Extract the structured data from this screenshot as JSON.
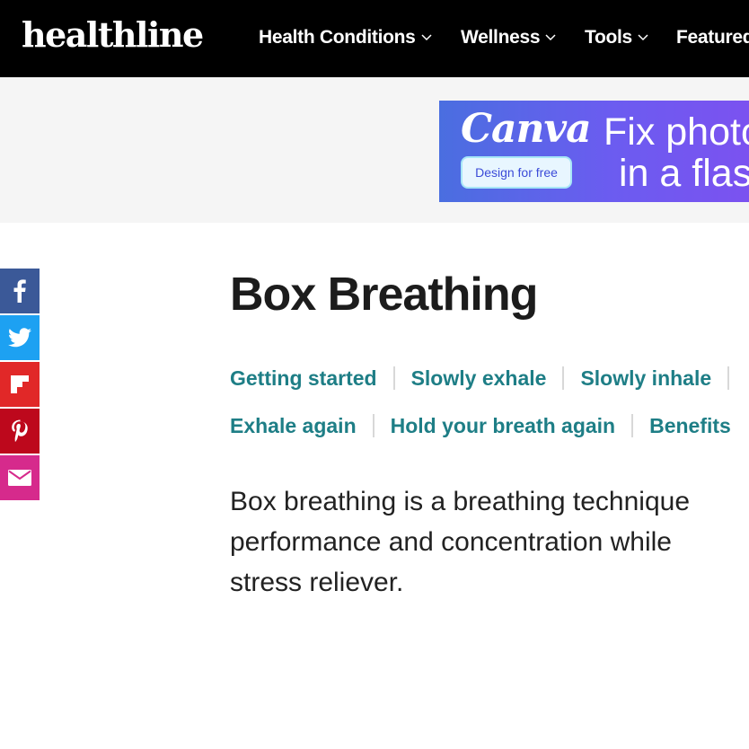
{
  "header": {
    "logo": "healthline",
    "nav": [
      {
        "label": "Health Conditions"
      },
      {
        "label": "Wellness"
      },
      {
        "label": "Tools"
      },
      {
        "label": "Featured"
      }
    ]
  },
  "ad": {
    "brand": "Canva",
    "cta": "Design for free",
    "headline_line1": "Fix photo",
    "headline_line2": "in a flash"
  },
  "share": [
    {
      "icon": "facebook-icon",
      "color": "#3b5998"
    },
    {
      "icon": "twitter-icon",
      "color": "#1da1f2"
    },
    {
      "icon": "flipboard-icon",
      "color": "#e12828"
    },
    {
      "icon": "pinterest-icon",
      "color": "#bd081c"
    },
    {
      "icon": "email-icon",
      "color": "#d62a8c"
    }
  ],
  "article": {
    "title": "Box Breathing",
    "toc_row1": [
      "Getting started",
      "Slowly exhale",
      "Slowly inhale"
    ],
    "toc_row2": [
      "Exhale again",
      "Hold your breath again",
      "Benefits"
    ],
    "intro_lines": [
      "Box breathing is a breathing technique",
      "performance and concentration while",
      "stress reliever."
    ]
  },
  "colors": {
    "nav_bg": "#000000",
    "toc_link": "#1e7e86",
    "ad_band": "#f5f5f5"
  }
}
